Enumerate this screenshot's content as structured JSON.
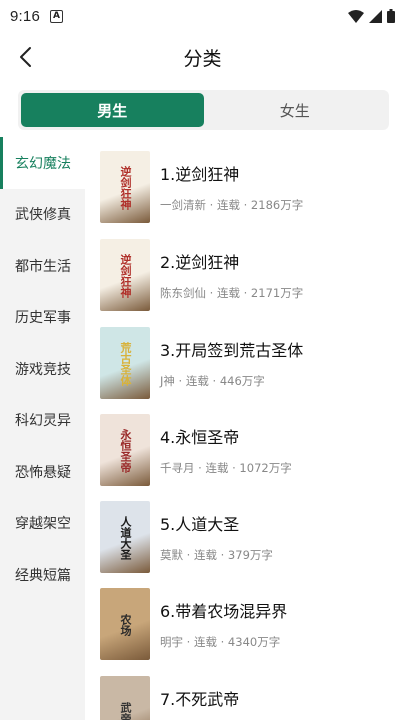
{
  "status_bar": {
    "time": "9:16",
    "notification_icon": "A"
  },
  "nav": {
    "title": "分类"
  },
  "gender_tabs": [
    {
      "label": "男生",
      "active": true
    },
    {
      "label": "女生",
      "active": false
    }
  ],
  "categories": [
    {
      "label": "玄幻魔法",
      "active": true
    },
    {
      "label": "武侠修真",
      "active": false
    },
    {
      "label": "都市生活",
      "active": false
    },
    {
      "label": "历史军事",
      "active": false
    },
    {
      "label": "游戏竞技",
      "active": false
    },
    {
      "label": "科幻灵异",
      "active": false
    },
    {
      "label": "恐怖悬疑",
      "active": false
    },
    {
      "label": "穿越架空",
      "active": false
    },
    {
      "label": "经典短篇",
      "active": false
    }
  ],
  "books": [
    {
      "title": "1.逆剑狂神",
      "meta": "一剑清新 · 连载 · 2186万字",
      "cover_text": "逆剑狂神",
      "cover_bg": "#f5efe4",
      "cover_accent": "#b0302a"
    },
    {
      "title": "2.逆剑狂神",
      "meta": "陈东剑仙 · 连载 · 2171万字",
      "cover_text": "逆剑狂神",
      "cover_bg": "#f5efe4",
      "cover_accent": "#b0302a"
    },
    {
      "title": "3.开局签到荒古圣体",
      "meta": "J神 · 连载 · 446万字",
      "cover_text": "荒古圣体",
      "cover_bg": "#cfe6e6",
      "cover_accent": "#d8b23a"
    },
    {
      "title": "4.永恒圣帝",
      "meta": "千寻月 · 连载 · 1072万字",
      "cover_text": "永恒圣帝",
      "cover_bg": "#efe3da",
      "cover_accent": "#9a2a2a"
    },
    {
      "title": "5.人道大圣",
      "meta": "莫默 · 连载 · 379万字",
      "cover_text": "人道大圣",
      "cover_bg": "#dde3ea",
      "cover_accent": "#1a1a1a"
    },
    {
      "title": "6.带着农场混异界",
      "meta": "明宇 · 连载 · 4340万字",
      "cover_text": "农场",
      "cover_bg": "#c8a67a",
      "cover_accent": "#2b2b2b"
    },
    {
      "title": "7.不死武帝",
      "meta": "",
      "cover_text": "武帝",
      "cover_bg": "#c9b8a5",
      "cover_accent": "#333333"
    }
  ]
}
